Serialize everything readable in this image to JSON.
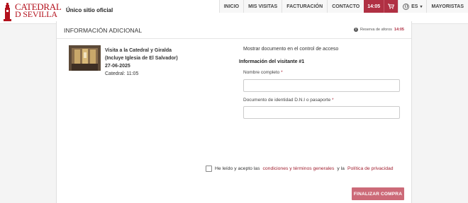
{
  "header": {
    "logo_line1": "CATEDRAL",
    "logo_line2": "D SEVILLA",
    "official": "Único sitio oficial",
    "nav": {
      "inicio": "INICIO",
      "mis_visitas": "MIS VISITAS",
      "facturacion": "FACTURACIÓN",
      "contacto": "CONTACTO",
      "timer": "14:05",
      "cart_icon": "cart-icon",
      "language": "ES",
      "mayoristas": "MAYORISTAS"
    }
  },
  "card": {
    "title": "INFORMACIÓN ADICIONAL",
    "info_prefix": "Reserva de aforos",
    "info_time": "14:05",
    "visit": {
      "name_line1": "Visita a la Catedral y Giralda",
      "name_line2": "(Incluye Iglesia de El Salvador)",
      "date": "27-06-2025",
      "session": "Catedral: 11:05"
    },
    "access_text": "Mostrar documento en el control de acceso",
    "visitor_heading": "Información del visitante #1",
    "fields": {
      "name_label": "Nombre completo",
      "id_label": "Documento de identidad D.N.I o pasaporte",
      "required_mark": "*",
      "name_value": "",
      "id_value": ""
    },
    "terms": {
      "prefix": "He leído y acepto las",
      "link1": "condiciones y términos generales",
      "middle": "y la",
      "link2": "Política de privacidad"
    },
    "submit": "FINALIZAR COMPRA"
  },
  "colors": {
    "brand": "#b3111d",
    "accent": "#b03043",
    "button": "#cc6a78"
  }
}
